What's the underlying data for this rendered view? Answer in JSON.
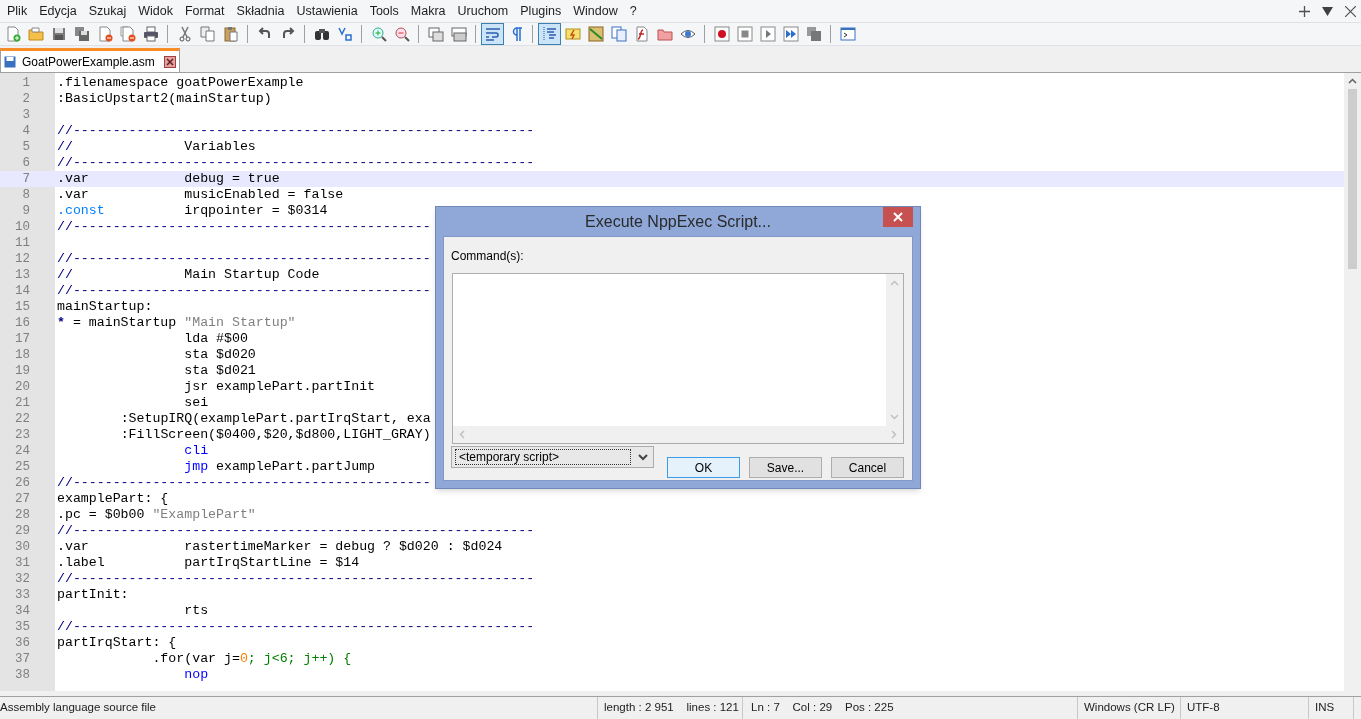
{
  "menu": [
    "Plik",
    "Edycja",
    "Szukaj",
    "Widok",
    "Format",
    "Składnia",
    "Ustawienia",
    "Tools",
    "Makra",
    "Uruchom",
    "Plugins",
    "Window",
    "?"
  ],
  "toolbar_groups": [
    [
      {
        "pressed": false
      },
      {
        "pressed": false
      },
      {
        "pressed": false
      },
      {
        "pressed": false
      },
      {
        "pressed": false
      },
      {
        "pressed": false
      },
      {
        "pressed": false
      }
    ],
    [
      {
        "pressed": false
      },
      {
        "pressed": false
      },
      {
        "pressed": false
      }
    ],
    [
      {
        "pressed": false
      },
      {
        "pressed": false
      }
    ],
    [
      {
        "pressed": false
      },
      {
        "pressed": false
      }
    ],
    [
      {
        "pressed": false
      },
      {
        "pressed": false
      }
    ],
    [
      {
        "pressed": false
      },
      {
        "pressed": false
      }
    ],
    [
      {
        "pressed": true
      },
      {
        "pressed": false
      }
    ],
    [
      {
        "pressed": true
      },
      {
        "pressed": false
      },
      {
        "pressed": false
      },
      {
        "pressed": false
      },
      {
        "pressed": false
      },
      {
        "pressed": false
      },
      {
        "pressed": false
      }
    ],
    [
      {
        "pressed": false
      },
      {
        "pressed": false
      },
      {
        "pressed": false
      },
      {
        "pressed": false
      },
      {
        "pressed": false
      }
    ],
    [
      {
        "pressed": false
      }
    ]
  ],
  "tabs": [
    {
      "label": "GoatPowerExample.asm",
      "selected": true
    }
  ],
  "editor": {
    "lines": [
      {
        "n": "1",
        "current": false,
        "segments": [
          {
            "kind": "plain",
            "text": ".filenamespace goatPowerExample"
          }
        ]
      },
      {
        "n": "2",
        "current": false,
        "segments": [
          {
            "kind": "plain",
            "text": ":BasicUpstart2(mainStartup)"
          }
        ]
      },
      {
        "n": "3",
        "current": false
      },
      {
        "n": "4",
        "current": false,
        "segments": [
          {
            "kind": "comment",
            "text": "//----------------------------------------------------------"
          }
        ]
      },
      {
        "n": "5",
        "current": false,
        "segments": [
          {
            "kind": "comment",
            "text": "//"
          },
          {
            "kind": "plain",
            "text": "\t\t\t\tVariables"
          }
        ]
      },
      {
        "n": "6",
        "current": false,
        "segments": [
          {
            "kind": "comment",
            "text": "//----------------------------------------------------------"
          }
        ]
      },
      {
        "n": "7",
        "current": true,
        "segments": [
          {
            "kind": "plain",
            "text": ".var\t\t\tdebug = true"
          }
        ]
      },
      {
        "n": "8",
        "current": false,
        "segments": [
          {
            "kind": "plain",
            "text": ".var\t\t\tmusicEnabled = false"
          }
        ]
      },
      {
        "n": "9",
        "current": false,
        "segments": [
          {
            "kind": "directive",
            "text": ".const"
          },
          {
            "kind": "plain",
            "text": "\t\t\tirqpointer = $0314"
          }
        ]
      },
      {
        "n": "10",
        "current": false,
        "segments": [
          {
            "kind": "comment",
            "text": "//---------------------------------------------"
          }
        ]
      },
      {
        "n": "11",
        "current": false
      },
      {
        "n": "12",
        "current": false,
        "segments": [
          {
            "kind": "comment",
            "text": "//---------------------------------------------"
          }
        ]
      },
      {
        "n": "13",
        "current": false,
        "segments": [
          {
            "kind": "comment",
            "text": "//"
          },
          {
            "kind": "plain",
            "text": "\t\t\t\tMain Startup Code"
          }
        ]
      },
      {
        "n": "14",
        "current": false,
        "segments": [
          {
            "kind": "comment",
            "text": "//---------------------------------------------"
          }
        ]
      },
      {
        "n": "15",
        "current": false,
        "segments": [
          {
            "kind": "plain",
            "text": "mainStartup:"
          }
        ]
      },
      {
        "n": "16",
        "current": false,
        "segments": [
          {
            "kind": "operator",
            "text": "*"
          },
          {
            "kind": "plain",
            "text": " = mainStartup "
          },
          {
            "kind": "string",
            "text": "\"Main Startup\""
          }
        ]
      },
      {
        "n": "17",
        "current": false,
        "segments": [
          {
            "kind": "plain",
            "text": "\t\t\t\tlda #$00"
          }
        ]
      },
      {
        "n": "18",
        "current": false,
        "segments": [
          {
            "kind": "plain",
            "text": "\t\t\t\tsta $d020"
          }
        ]
      },
      {
        "n": "19",
        "current": false,
        "segments": [
          {
            "kind": "plain",
            "text": "\t\t\t\tsta $d021"
          }
        ]
      },
      {
        "n": "20",
        "current": false,
        "segments": [
          {
            "kind": "plain",
            "text": "\t\t\t\tjsr examplePart.partInit"
          }
        ]
      },
      {
        "n": "21",
        "current": false,
        "segments": [
          {
            "kind": "plain",
            "text": "\t\t\t\tsei"
          }
        ]
      },
      {
        "n": "22",
        "current": false,
        "segments": [
          {
            "kind": "plain",
            "text": "\t\t:SetupIRQ(examplePart.partIrqStart, exa"
          }
        ]
      },
      {
        "n": "23",
        "current": false,
        "segments": [
          {
            "kind": "plain",
            "text": "\t\t:FillScreen($0400,$20,$d800,LIGHT_GRAY)"
          }
        ]
      },
      {
        "n": "24",
        "current": false,
        "segments": [
          {
            "kind": "keyword",
            "text": "\t\t\t\tcli"
          }
        ]
      },
      {
        "n": "25",
        "current": false,
        "segments": [
          {
            "kind": "keyword",
            "text": "\t\t\t\tjmp"
          },
          {
            "kind": "plain",
            "text": " examplePart.partJump"
          }
        ]
      },
      {
        "n": "26",
        "current": false,
        "segments": [
          {
            "kind": "comment",
            "text": "//---------------------------------------------"
          }
        ]
      },
      {
        "n": "27",
        "current": false,
        "segments": [
          {
            "kind": "plain",
            "text": "examplePart: {"
          }
        ]
      },
      {
        "n": "28",
        "current": false,
        "segments": [
          {
            "kind": "plain",
            "text": ".pc = $0b00 "
          },
          {
            "kind": "string",
            "text": "\"ExamplePart\""
          }
        ]
      },
      {
        "n": "29",
        "current": false,
        "segments": [
          {
            "kind": "comment",
            "text": "//----------------------------------------------------------"
          }
        ]
      },
      {
        "n": "30",
        "current": false,
        "segments": [
          {
            "kind": "plain",
            "text": ".var\t\t\trastertimeMarker = debug ? $d020 : $d024"
          }
        ]
      },
      {
        "n": "31",
        "current": false,
        "segments": [
          {
            "kind": "plain",
            "text": ".label\t\t\tpartIrqStartLine = $14"
          }
        ]
      },
      {
        "n": "32",
        "current": false,
        "segments": [
          {
            "kind": "comment",
            "text": "//----------------------------------------------------------"
          }
        ]
      },
      {
        "n": "33",
        "current": false,
        "segments": [
          {
            "kind": "plain",
            "text": "partInit:"
          }
        ]
      },
      {
        "n": "34",
        "current": false,
        "segments": [
          {
            "kind": "plain",
            "text": "\t\t\t\trts"
          }
        ]
      },
      {
        "n": "35",
        "current": false,
        "segments": [
          {
            "kind": "comment",
            "text": "//----------------------------------------------------------"
          }
        ]
      },
      {
        "n": "36",
        "current": false,
        "segments": [
          {
            "kind": "plain",
            "text": "partIrqStart: {"
          }
        ]
      },
      {
        "n": "37",
        "current": false,
        "segments": [
          {
            "kind": "plain",
            "text": "\t\t\t.for(var j="
          },
          {
            "kind": "number",
            "text": "0"
          },
          {
            "kind": "green",
            "text": "; j<6; j++) {"
          }
        ]
      },
      {
        "n": "38",
        "current": false,
        "segments": [
          {
            "kind": "keyword",
            "text": "\t\t\t\tnop"
          }
        ]
      }
    ]
  },
  "dialog": {
    "title": "Execute NppExec Script...",
    "label": "Command(s):",
    "script_select": "<temporary script>",
    "buttons": [
      {
        "label": "OK",
        "default": true
      },
      {
        "label": "Save...",
        "default": false
      },
      {
        "label": "Cancel",
        "default": false
      }
    ]
  },
  "status_bar": [
    "Assembly language source file",
    "length : 2 951    lines : 121",
    "Ln : 7    Col : 29    Pos : 225",
    "Windows (CR LF)",
    "UTF-8",
    "INS"
  ]
}
